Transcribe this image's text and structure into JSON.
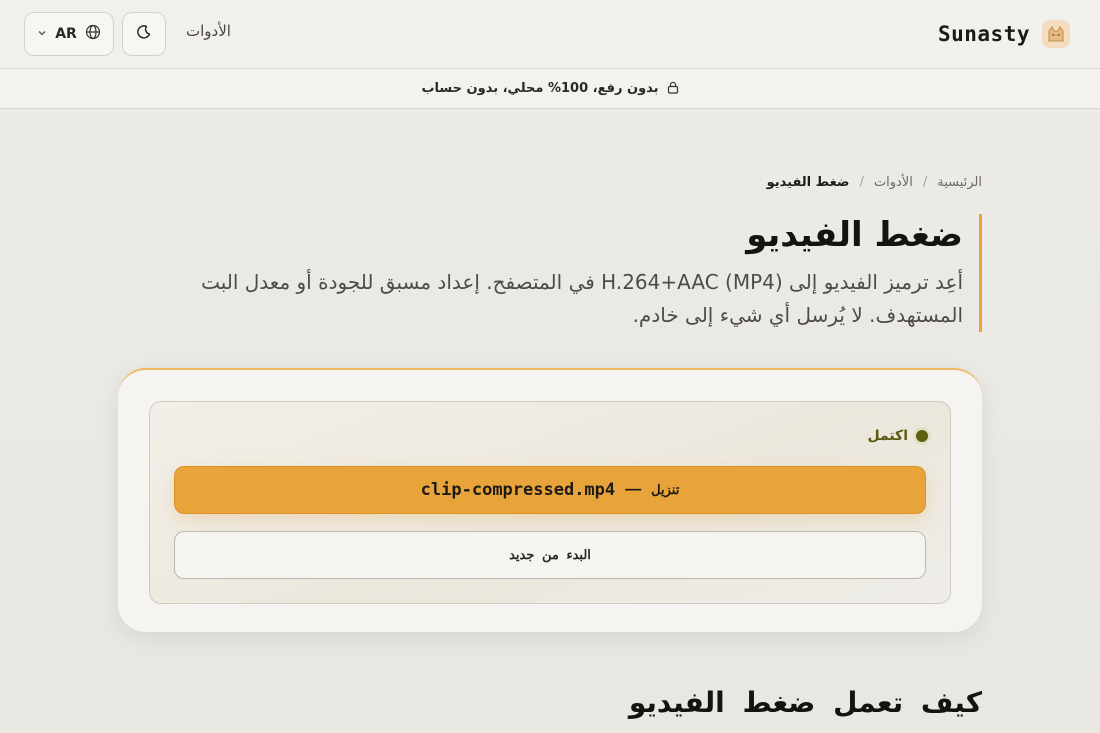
{
  "header": {
    "brand_name": "Sunasty",
    "brand_icon": "cat-icon",
    "tools_link": "الأدوات",
    "theme_icon": "moon-icon",
    "language_code": "AR",
    "language_icon": "globe-icon"
  },
  "privacy": {
    "icon": "lock-icon",
    "text": "بدون رفع، 100% محلي، بدون حساب"
  },
  "breadcrumb": {
    "home": "الرئيسية",
    "tools": "الأدوات",
    "current": "ضغط الفيديو"
  },
  "page": {
    "title": "ضغط الفيديو",
    "description": "أعِد ترميز الفيديو إلى H.264+AAC (MP4) في المتصفح. إعداد مسبق للجودة أو معدل البت المستهدف. لا يُرسل أي شيء إلى خادم."
  },
  "result": {
    "status": "اكتمل",
    "download_label": "تنزيل",
    "download_separator": "—",
    "download_file": "clip-compressed.mp4",
    "restart_label": "البدء من جديد"
  },
  "section": {
    "how_title": "كيف تعمل ضغط الفيديو"
  },
  "colors": {
    "accent": "#e8a33a",
    "status": "#5d6010"
  }
}
